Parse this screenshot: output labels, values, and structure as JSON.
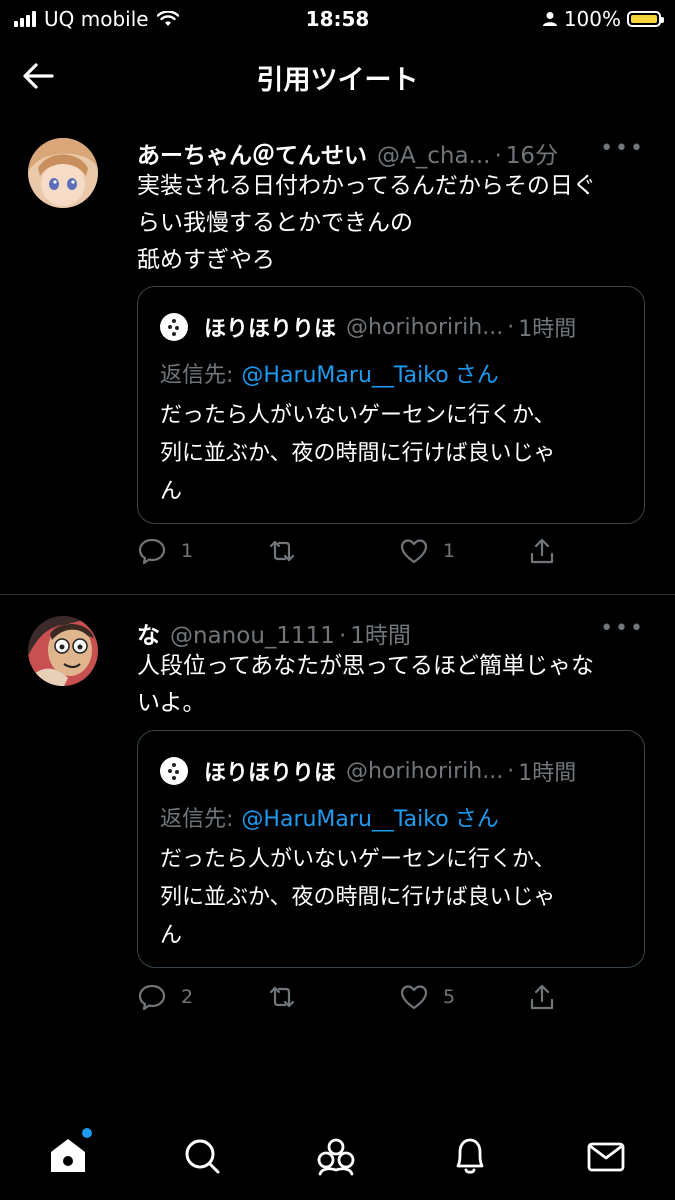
{
  "status_bar": {
    "carrier": "UQ mobile",
    "time": "18:58",
    "battery": "100%"
  },
  "header": {
    "title": "引用ツイート"
  },
  "tweets": [
    {
      "name": "あーちゃん＠てんせい",
      "handle": "@A_cha...",
      "time": "16分",
      "text_lines": [
        "実装される日付わかってるんだからその日ぐ",
        "らい我慢するとかできんの",
        "舐めすぎやろ"
      ],
      "quote": {
        "name": "ほりほりりほ",
        "handle": "@horihoririh...",
        "time": "1時間",
        "reply_label": "返信先:",
        "reply_to": "@HaruMaru__Taiko",
        "reply_suffix": "さん",
        "text_lines": [
          "だったら人がいないゲーセンに行くか、",
          "列に並ぶか、夜の時間に行けば良いじゃ",
          "ん"
        ]
      },
      "replies": "1",
      "likes": "1"
    },
    {
      "name": "な",
      "handle": "@nanou_1111",
      "time": "1時間",
      "text_lines": [
        "人段位ってあなたが思ってるほど簡単じゃな",
        "いよ。"
      ],
      "quote": {
        "name": "ほりほりりほ",
        "handle": "@horihoririh...",
        "time": "1時間",
        "reply_label": "返信先:",
        "reply_to": "@HaruMaru__Taiko",
        "reply_suffix": "さん",
        "text_lines": [
          "だったら人がいないゲーセンに行くか、",
          "列に並ぶか、夜の時間に行けば良いじゃ",
          "ん"
        ]
      },
      "replies": "2",
      "likes": "5"
    }
  ],
  "colors": {
    "background": "#000000",
    "link": "#1d9bf0",
    "muted": "#71767b",
    "battery": "#f5d33b"
  },
  "icons": [
    "back-arrow-icon",
    "more-icon",
    "reply-icon",
    "retweet-icon",
    "like-icon",
    "share-icon",
    "home-icon",
    "search-icon",
    "communities-icon",
    "notifications-icon",
    "messages-icon"
  ]
}
